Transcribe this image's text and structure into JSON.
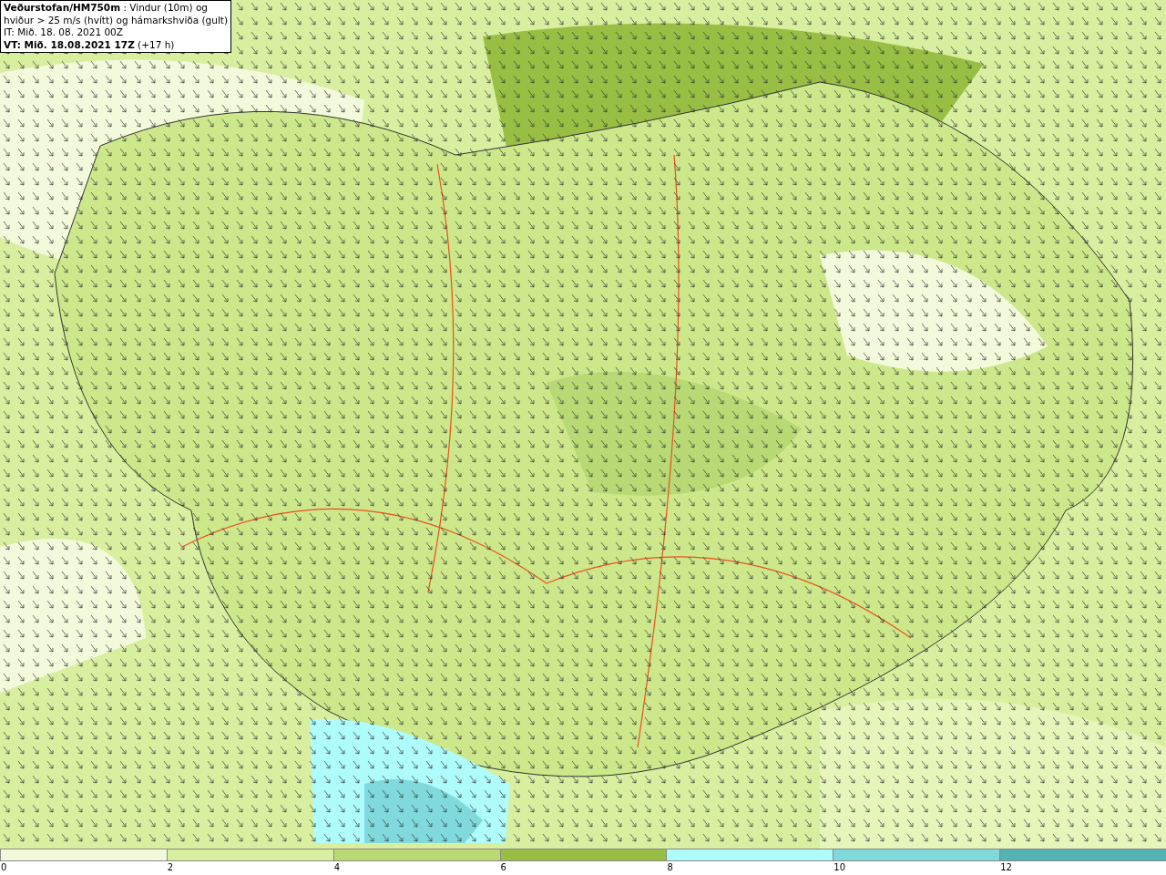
{
  "header": {
    "lines": [
      "**Veðurstofan/HM750m** : Vindur (10m) og",
      "hviður > 25 m/s (hvítt) og hámarkshviða (gult)",
      "IT: Mið. 18. 08. 2021 00Z",
      "**VT: Mið. 18.08.2021 17Z** (+17 h)"
    ]
  },
  "legend": [
    {
      "label": "0",
      "color": "#f3fadc"
    },
    {
      "label": "2",
      "color": "#d9efa0"
    },
    {
      "label": "4",
      "color": "#b9d974"
    },
    {
      "label": "6",
      "color": "#98bf44"
    },
    {
      "label": "8",
      "color": "#aefcfc"
    },
    {
      "label": "10",
      "color": "#80dadc"
    },
    {
      "label": "12",
      "color": "#52b2b4"
    }
  ]
}
